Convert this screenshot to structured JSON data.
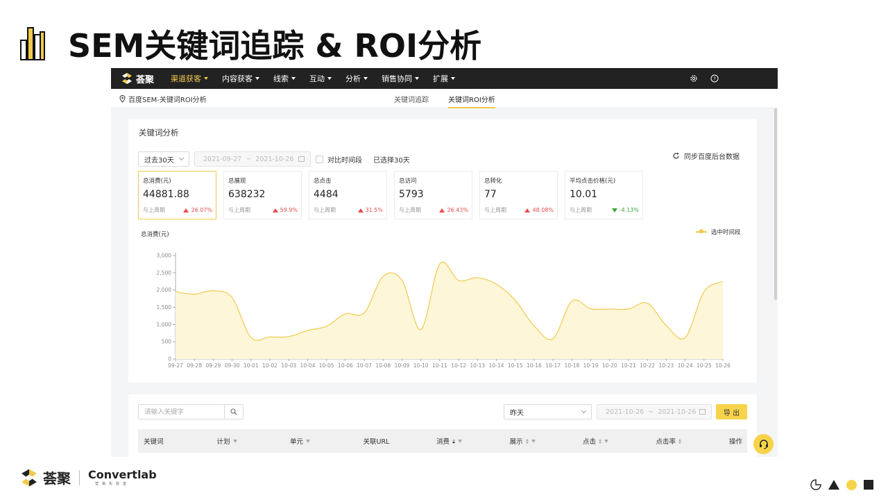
{
  "slide": {
    "title": "SEM关键词追踪 & ROI分析"
  },
  "app": {
    "brand": "荟聚",
    "nav": [
      {
        "label": "渠道获客",
        "active": true
      },
      {
        "label": "内容获客",
        "active": false
      },
      {
        "label": "线索",
        "active": false
      },
      {
        "label": "互动",
        "active": false
      },
      {
        "label": "分析",
        "active": false
      },
      {
        "label": "销售协同",
        "active": false
      },
      {
        "label": "扩展",
        "active": false
      }
    ],
    "nav_icons": [
      "gear-icon",
      "help-circle-icon"
    ],
    "breadcrumb": "百度SEM-关键词ROI分析",
    "subtabs": [
      {
        "label": "关键词追踪",
        "active": false
      },
      {
        "label": "关键词ROI分析",
        "active": true
      }
    ]
  },
  "analysis": {
    "title": "关键词分析",
    "range_select": "过去30天",
    "date_start": "2021-09-27",
    "date_sep": "~",
    "date_end": "2021-10-26",
    "compare_label": "对比时间段",
    "selected_days": "已选择30天",
    "sync_label": "同步百度后台数据",
    "metrics": [
      {
        "label": "总消费(元)",
        "value": "44881.88",
        "compare": "与上周期",
        "change": "26.07%",
        "direction": "up",
        "active": true
      },
      {
        "label": "总展现",
        "value": "638232",
        "compare": "与上周期",
        "change": "59.9%",
        "direction": "up",
        "active": false
      },
      {
        "label": "总点击",
        "value": "4484",
        "compare": "与上周期",
        "change": "31.5%",
        "direction": "up",
        "active": false
      },
      {
        "label": "总访问",
        "value": "5793",
        "compare": "与上周期",
        "change": "26.43%",
        "direction": "up",
        "active": false
      },
      {
        "label": "总转化",
        "value": "77",
        "compare": "与上周期",
        "change": "48.08%",
        "direction": "up",
        "active": false
      },
      {
        "label": "平均点击价格(元)",
        "value": "10.01",
        "compare": "与上周期",
        "change": "-4.13%",
        "direction": "down",
        "active": false
      }
    ]
  },
  "chart_data": {
    "type": "area",
    "ylabel": "总消费(元)",
    "legend": "选中时间段",
    "legend_position": "top-right",
    "ylim": [
      0,
      3000
    ],
    "yticks": [
      "0",
      "500",
      "1,000",
      "1,500",
      "2,000",
      "2,500",
      "3,000"
    ],
    "x": [
      "09-27",
      "09-28",
      "09-29",
      "09-30",
      "10-01",
      "10-02",
      "10-03",
      "10-04",
      "10-05",
      "10-06",
      "10-07",
      "10-08",
      "10-09",
      "10-10",
      "10-11",
      "10-12",
      "10-13",
      "10-14",
      "10-15",
      "10-16",
      "10-17",
      "10-18",
      "10-19",
      "10-20",
      "10-21",
      "10-22",
      "10-23",
      "10-24",
      "10-25",
      "10-26"
    ],
    "series": [
      {
        "name": "选中时间段",
        "values": [
          1950,
          1880,
          1980,
          1780,
          620,
          640,
          650,
          830,
          950,
          1310,
          1340,
          2400,
          2280,
          860,
          2760,
          2280,
          2360,
          2170,
          1700,
          960,
          590,
          1680,
          1460,
          1450,
          1450,
          1620,
          970,
          620,
          1950,
          2250
        ]
      }
    ],
    "color": "#f2c94c",
    "grid": false
  },
  "table": {
    "search_placeholder": "请输入关键字",
    "period_select": "昨天",
    "date_start": "2021-10-26",
    "date_sep": "~",
    "date_end": "2021-10-26",
    "export_label": "导 出",
    "columns": [
      {
        "label": "关键词",
        "filter": false,
        "sort": false
      },
      {
        "label": "计划",
        "filter": true,
        "sort": false
      },
      {
        "label": "单元",
        "filter": true,
        "sort": false
      },
      {
        "label": "关联URL",
        "filter": false,
        "sort": false
      },
      {
        "label": "消费",
        "filter": true,
        "sort": true,
        "sort_dir": "desc"
      },
      {
        "label": "展示",
        "filter": true,
        "sort": true
      },
      {
        "label": "点击",
        "filter": true,
        "sort": true
      },
      {
        "label": "点击率",
        "filter": false,
        "sort": true
      },
      {
        "label": "操作",
        "filter": false,
        "sort": false
      }
    ]
  },
  "footer": {
    "brand": "荟聚",
    "partner": "Convertlab",
    "partner_sub": "营销实验室"
  },
  "colors": {
    "accent": "#f2c94c",
    "nav_bg": "#222222",
    "up": "#e84b4b",
    "down": "#3ba53b"
  }
}
